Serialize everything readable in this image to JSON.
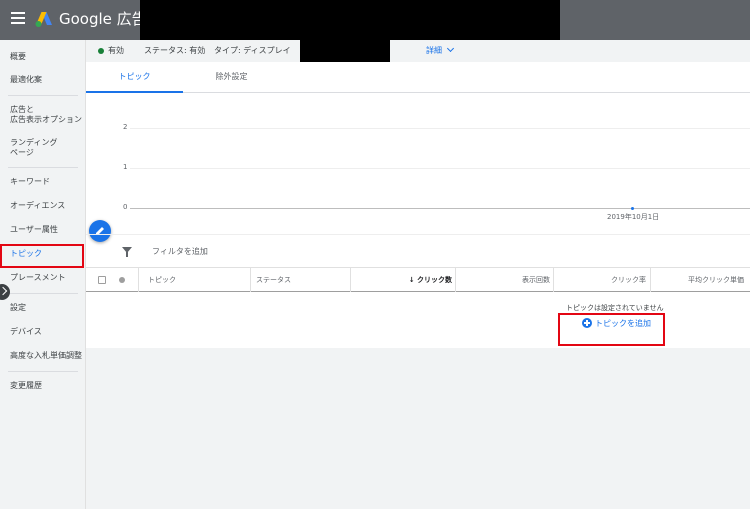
{
  "app": {
    "product_name": "Google 広告"
  },
  "sidebar": {
    "items": [
      {
        "label": "概要"
      },
      {
        "label": "最適化案"
      },
      {
        "label": "広告と\n広告表示オプション"
      },
      {
        "label": "ランディング\nページ"
      },
      {
        "label": "キーワード"
      },
      {
        "label": "オーディエンス"
      },
      {
        "label": "ユーザー属性"
      },
      {
        "label": "トピック",
        "active": true
      },
      {
        "label": "プレースメント"
      },
      {
        "label": "設定"
      },
      {
        "label": "デバイス"
      },
      {
        "label": "高度な入札単価調整"
      },
      {
        "label": "変更履歴"
      }
    ]
  },
  "status_bar": {
    "status_value": "有効",
    "status_label": "ステータス: 有効",
    "type_label": "タイプ: ディスプレイ",
    "details_label": "詳細"
  },
  "tabs": [
    {
      "label": "トピック",
      "active": true
    },
    {
      "label": "除外設定",
      "active": false
    }
  ],
  "chart_data": {
    "type": "line",
    "y_ticks": [
      "2",
      "1",
      "0"
    ],
    "ylim": [
      0,
      2
    ],
    "x_tick_labels": [
      "2019年10月1日"
    ],
    "series": [
      {
        "values": [
          0
        ]
      }
    ],
    "grid": true
  },
  "filter": {
    "label": "フィルタを追加"
  },
  "table": {
    "columns": [
      "トピック",
      "ステータス",
      "クリック数",
      "表示回数",
      "クリック率",
      "平均クリック単価"
    ],
    "sorted_column": "クリック数",
    "empty_message": "トピックは設定されていません",
    "add_label": "トピックを追加"
  },
  "colors": {
    "accent": "#1a73e8",
    "highlight": "#e30613",
    "topbar": "#5f6368",
    "status_ok": "#188038"
  }
}
